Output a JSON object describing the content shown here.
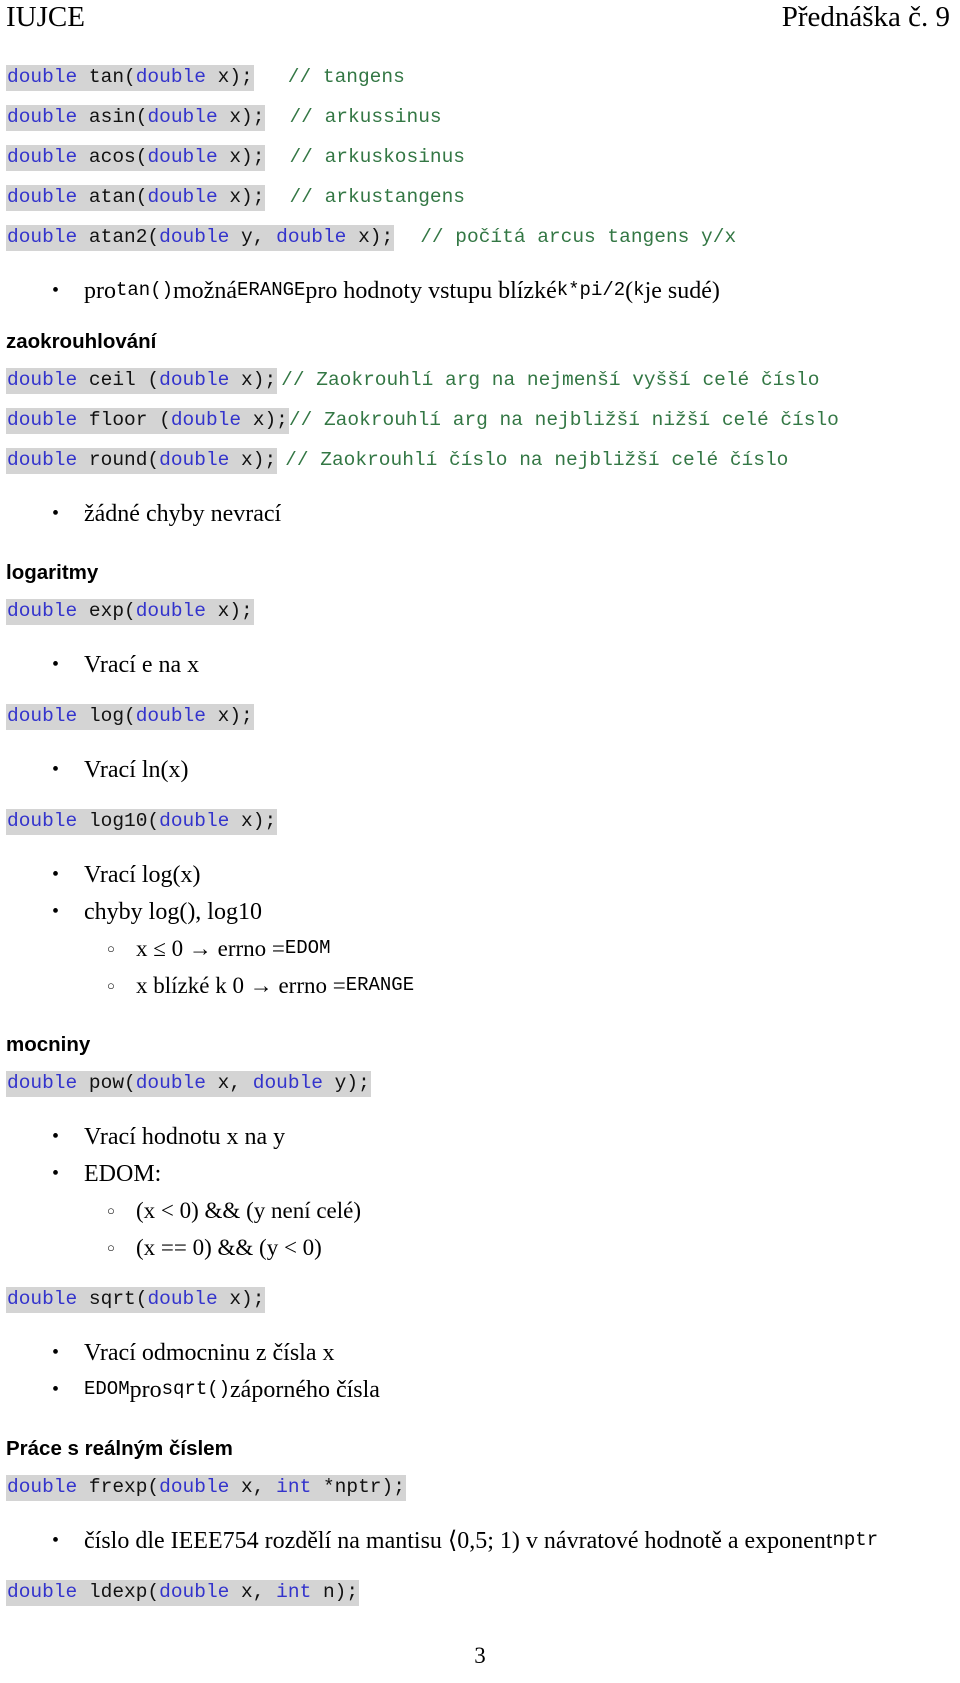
{
  "header": {
    "left": "IUJCE",
    "right": "Přednáška č. 9"
  },
  "page_number": "3",
  "code": {
    "tan": {
      "kw1": "double",
      "name": " tan(",
      "kw2": "double",
      "tail": " x);",
      "comment": "// tangens"
    },
    "asin": {
      "kw1": "double",
      "name": " asin(",
      "kw2": "double",
      "tail": " x);",
      "comment": "// arkussinus"
    },
    "acos": {
      "kw1": "double",
      "name": " acos(",
      "kw2": "double",
      "tail": " x);",
      "comment": "// arkuskosinus"
    },
    "atan": {
      "kw1": "double",
      "name": " atan(",
      "kw2": "double",
      "tail": " x);",
      "comment": "// arkustangens"
    },
    "atan2": {
      "kw1": "double",
      "name": " atan2(",
      "kw2": "double",
      "mid": " y, ",
      "kw3": "double",
      "tail": " x);",
      "comment": "// počítá arcus tangens y/x"
    },
    "ceil": {
      "kw1": "double",
      "name": " ceil (",
      "kw2": "double",
      "tail": " x);",
      "comment": "// Zaokrouhlí arg na nejmenší vyšší celé číslo"
    },
    "floor": {
      "kw1": "double",
      "name": " floor (",
      "kw2": "double",
      "tail": " x);",
      "comment": "// Zaokrouhlí arg na nejbližší nižší celé číslo"
    },
    "round": {
      "kw1": "double",
      "name": " round(",
      "kw2": "double",
      "tail": " x);",
      "comment": "// Zaokrouhlí číslo na nejbližší celé číslo"
    },
    "exp": {
      "kw1": "double",
      "name": " exp(",
      "kw2": "double",
      "tail": " x);",
      "comment": ""
    },
    "log": {
      "kw1": "double",
      "name": " log(",
      "kw2": "double",
      "tail": " x);",
      "comment": ""
    },
    "log10": {
      "kw1": "double",
      "name": " log10(",
      "kw2": "double",
      "tail": " x);",
      "comment": ""
    },
    "pow": {
      "kw1": "double",
      "name": " pow(",
      "kw2": "double",
      "mid": " x, ",
      "kw3": "double",
      "tail": " y);",
      "comment": ""
    },
    "sqrt": {
      "kw1": "double",
      "name": " sqrt(",
      "kw2": "double",
      "tail": " x);",
      "comment": ""
    },
    "frexp": {
      "kw1": "double",
      "name": " frexp(",
      "kw2": "double",
      "mid": " x, ",
      "kw3": "int",
      "tail": " *nptr);",
      "comment": ""
    },
    "ldexp": {
      "kw1": "double",
      "name": " ldexp(",
      "kw2": "double",
      "mid": " x, ",
      "kw3": "int",
      "tail": " n);",
      "comment": ""
    }
  },
  "bullets": {
    "tan_erange": {
      "p1": "pro ",
      "c1": "tan()",
      "p2": " možná ",
      "c2": "ERANGE",
      "p3": " pro hodnoty vstupu blízké ",
      "c3": "k*pi/2",
      "p4": " (",
      "c4": "k",
      "p5": " je sudé)"
    },
    "no_errors": "žádné chyby nevrací",
    "exp_desc": "Vrací e na x",
    "log_desc": "Vrací ln(x)",
    "log10_desc": "Vrací log(x)",
    "log_errors": "chyby log(), log10",
    "log_err_1": {
      "text": "x ≤ 0 → errno = ",
      "code": "EDOM"
    },
    "log_err_2": {
      "text": "x blízké k 0 → errno = ",
      "code": "ERANGE"
    },
    "pow_desc": "Vrací hodnotu x na y",
    "pow_edom": "EDOM:",
    "pow_edom_1": "(x < 0) && (y není celé)",
    "pow_edom_2": "(x == 0) && (y < 0)",
    "sqrt_desc": "Vrací odmocninu z čísla x",
    "sqrt_edom": {
      "c1": "EDOM",
      "p1": " pro ",
      "c2": "sqrt()",
      "p2": " záporného čísla"
    },
    "frexp_desc": {
      "p1": "číslo dle IEEE754 rozdělí na mantisu ⟨0,5; 1) v návratové hodnotě a exponent ",
      "c1": "nptr"
    }
  },
  "headings": {
    "rounding": "zaokrouhlování",
    "logarithms": "logaritmy",
    "powers": "mocniny",
    "real_numbers": "Práce s reálným číslem"
  },
  "colors": {
    "keyword": "#3333cc",
    "comment": "#337744",
    "code_background": "#d4d4d4"
  }
}
